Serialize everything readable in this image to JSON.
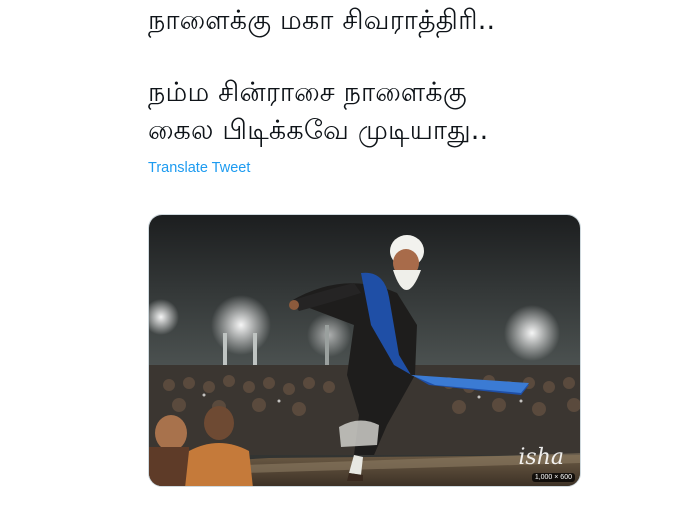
{
  "tweet": {
    "lines": [
      "நாளைக்கு மகா சிவராத்திரி..",
      "நம்ம சின்ராசை நாளைக்கு",
      "கைல பிடிக்கவே முடியாது.."
    ],
    "translate_label": "Translate Tweet"
  },
  "media": {
    "watermark": "isha",
    "dimensions": "1,000 × 600"
  }
}
